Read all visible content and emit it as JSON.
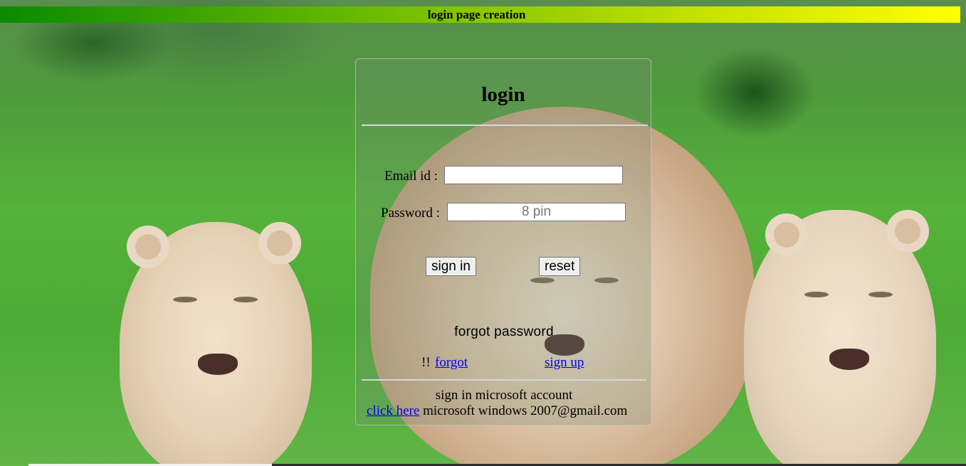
{
  "header": {
    "title": "login page creation"
  },
  "form": {
    "title": "login",
    "email_label": "Email id :",
    "email_value": "",
    "password_label": "Password :",
    "password_placeholder": "8 pin",
    "signin_label": "sign in",
    "reset_label": "reset",
    "forgot_heading": "forgot password",
    "bang": "!!",
    "forgot_link": "forgot",
    "signup_link": "sign up"
  },
  "footer": {
    "ms_text": "sign in microsoft account",
    "click_here": "click here",
    "email_text": " microsoft windows 2007@gmail.com"
  },
  "colors": {
    "header_gradient_start": "#0a8a00",
    "header_gradient_end": "#ffff00",
    "link": "#0000ee"
  }
}
